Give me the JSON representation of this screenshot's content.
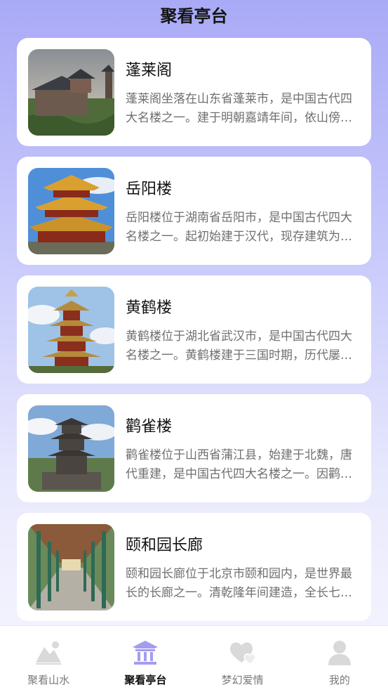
{
  "header": {
    "title": "聚看亭台"
  },
  "cards": [
    {
      "title": "蓬莱阁",
      "desc": "蓬莱阁坐落在山东省蓬莱市，是中国古代四大名楼之一。建于明朝嘉靖年间，依山傍海，景色壮丽。",
      "image": "penglai-pavilion-photo"
    },
    {
      "title": "岳阳楼",
      "desc": "岳阳楼位于湖南省岳阳市，是中国古代四大名楼之一。起初始建于汉代，现存建筑为清代重修。",
      "image": "yueyang-tower-photo"
    },
    {
      "title": "黄鹤楼",
      "desc": "黄鹤楼位于湖北省武汉市，是中国古代四大名楼之一。黄鹤楼建于三国时期，历代屡毁屡建。",
      "image": "yellow-crane-tower-photo"
    },
    {
      "title": "鹳雀楼",
      "desc": "鹳雀楼位于山西省蒲江县，始建于北魏，唐代重建，是中国古代四大名楼之一。因鹳雀栖息而得名。",
      "image": "guanque-tower-photo"
    },
    {
      "title": "颐和园长廊",
      "desc": "颐和园长廊位于北京市颐和园内，是世界最长的长廊之一。清乾隆年间建造，全长七百余米。",
      "image": "summer-palace-corridor-photo"
    }
  ],
  "tabbar": {
    "tabs": [
      {
        "label": "聚看山水",
        "icon": "mountain-icon"
      },
      {
        "label": "聚看亭台",
        "icon": "pavilion-icon",
        "active": true
      },
      {
        "label": "梦幻爱情",
        "icon": "hearts-icon"
      },
      {
        "label": "我的",
        "icon": "user-icon"
      }
    ]
  },
  "colors": {
    "accent": "#a49cf0",
    "bg_top": "#a9aaf6",
    "tab_inactive": "#d9d9d9"
  }
}
